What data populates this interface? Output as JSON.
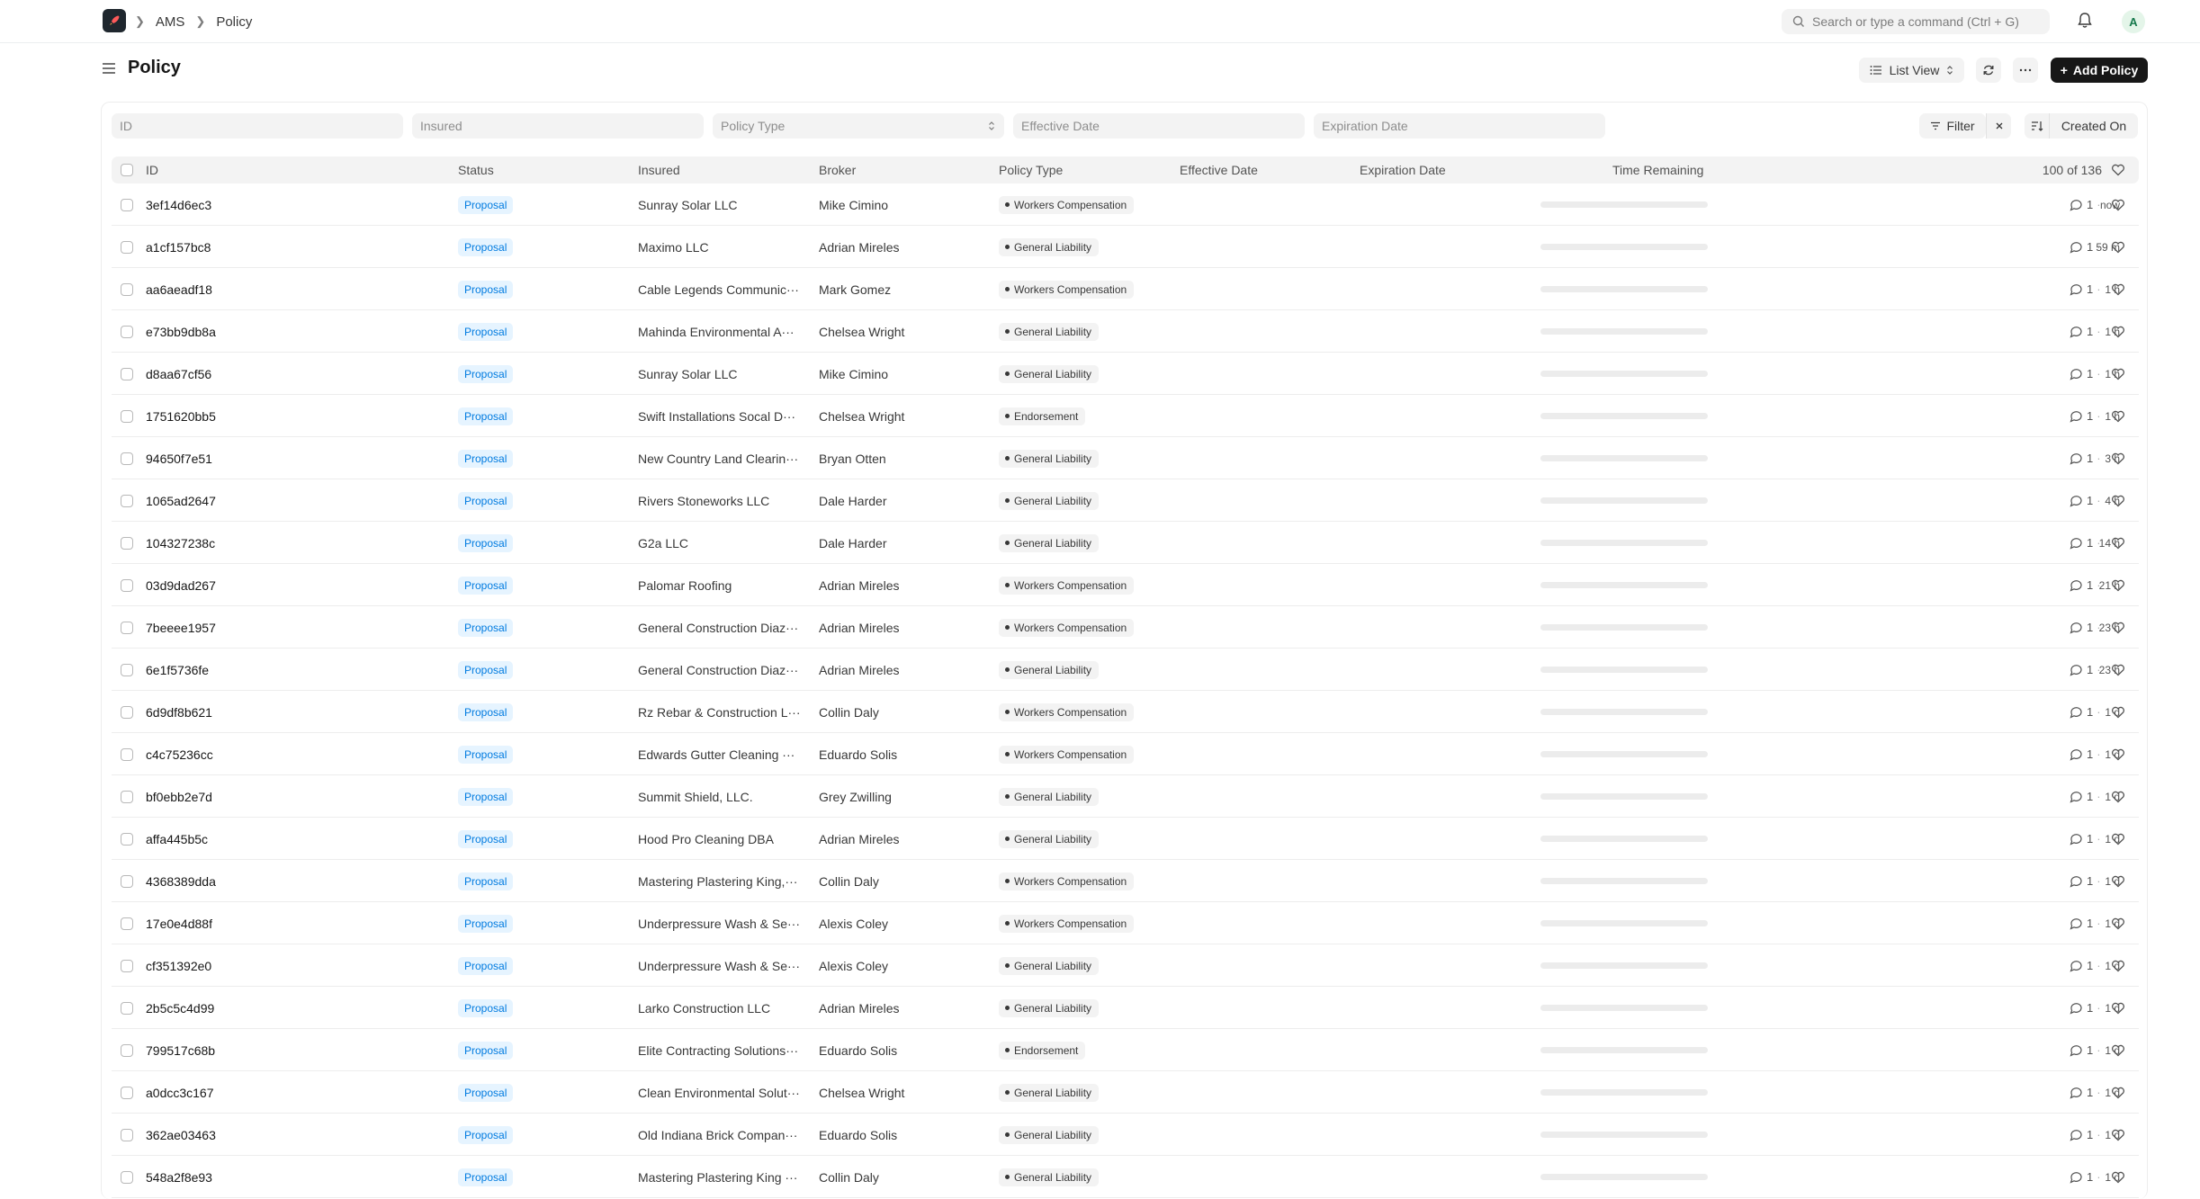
{
  "breadcrumbs": [
    "AMS",
    "Policy"
  ],
  "search": {
    "placeholder": "Search or type a command (Ctrl + G)"
  },
  "user": {
    "initial": "A"
  },
  "page": {
    "title": "Policy"
  },
  "toolbar": {
    "view_label": "List View",
    "add_label": "Add Policy"
  },
  "filters": {
    "id_placeholder": "ID",
    "insured_placeholder": "Insured",
    "policy_type_placeholder": "Policy Type",
    "effective_date_placeholder": "Effective Date",
    "expiration_date_placeholder": "Expiration Date",
    "filter_label": "Filter",
    "sort_label": "Created On"
  },
  "table": {
    "columns": {
      "id": "ID",
      "status": "Status",
      "insured": "Insured",
      "broker": "Broker",
      "policy_type": "Policy Type",
      "effective_date": "Effective Date",
      "expiration_date": "Expiration Date",
      "time_remaining": "Time Remaining"
    },
    "count": "100 of 136",
    "rows": [
      {
        "id": "3ef14d6ec3",
        "status": "Proposal",
        "insured": "Sunray Solar LLC",
        "broker": "Mike Cimino",
        "policy_type": "Workers Compensation",
        "time": "now",
        "comments": "1"
      },
      {
        "id": "a1cf157bc8",
        "status": "Proposal",
        "insured": "Maximo LLC",
        "broker": "Adrian Mireles",
        "policy_type": "General Liability",
        "time": "59 m",
        "comments": "1"
      },
      {
        "id": "aa6aeadf18",
        "status": "Proposal",
        "insured": "Cable Legends Communic···",
        "broker": "Mark Gomez",
        "policy_type": "Workers Compensation",
        "time": "1 h",
        "comments": "1"
      },
      {
        "id": "e73bb9db8a",
        "status": "Proposal",
        "insured": "Mahinda Environmental A···",
        "broker": "Chelsea Wright",
        "policy_type": "General Liability",
        "time": "1 h",
        "comments": "1"
      },
      {
        "id": "d8aa67cf56",
        "status": "Proposal",
        "insured": "Sunray Solar LLC",
        "broker": "Mike Cimino",
        "policy_type": "General Liability",
        "time": "1 h",
        "comments": "1"
      },
      {
        "id": "1751620bb5",
        "status": "Proposal",
        "insured": "Swift Installations Socal D···",
        "broker": "Chelsea Wright",
        "policy_type": "Endorsement",
        "time": "1 h",
        "comments": "1"
      },
      {
        "id": "94650f7e51",
        "status": "Proposal",
        "insured": "New Country Land Clearin···",
        "broker": "Bryan Otten",
        "policy_type": "General Liability",
        "time": "3 h",
        "comments": "1"
      },
      {
        "id": "1065ad2647",
        "status": "Proposal",
        "insured": "Rivers Stoneworks LLC",
        "broker": "Dale Harder",
        "policy_type": "General Liability",
        "time": "4 h",
        "comments": "1"
      },
      {
        "id": "104327238c",
        "status": "Proposal",
        "insured": "G2a LLC",
        "broker": "Dale Harder",
        "policy_type": "General Liability",
        "time": "14 h",
        "comments": "1"
      },
      {
        "id": "03d9dad267",
        "status": "Proposal",
        "insured": "Palomar Roofing",
        "broker": "Adrian Mireles",
        "policy_type": "Workers Compensation",
        "time": "21 h",
        "comments": "1"
      },
      {
        "id": "7beeee1957",
        "status": "Proposal",
        "insured": "General Construction Diaz···",
        "broker": "Adrian Mireles",
        "policy_type": "Workers Compensation",
        "time": "23 h",
        "comments": "1"
      },
      {
        "id": "6e1f5736fe",
        "status": "Proposal",
        "insured": "General Construction Diaz···",
        "broker": "Adrian Mireles",
        "policy_type": "General Liability",
        "time": "23 h",
        "comments": "1"
      },
      {
        "id": "6d9df8b621",
        "status": "Proposal",
        "insured": "Rz Rebar & Construction L···",
        "broker": "Collin Daly",
        "policy_type": "Workers Compensation",
        "time": "1 d",
        "comments": "1"
      },
      {
        "id": "c4c75236cc",
        "status": "Proposal",
        "insured": "Edwards Gutter Cleaning ···",
        "broker": "Eduardo Solis",
        "policy_type": "Workers Compensation",
        "time": "1 d",
        "comments": "1"
      },
      {
        "id": "bf0ebb2e7d",
        "status": "Proposal",
        "insured": "Summit Shield, LLC.",
        "broker": "Grey Zwilling",
        "policy_type": "General Liability",
        "time": "1 d",
        "comments": "1"
      },
      {
        "id": "affa445b5c",
        "status": "Proposal",
        "insured": "Hood Pro Cleaning DBA",
        "broker": "Adrian Mireles",
        "policy_type": "General Liability",
        "time": "1 d",
        "comments": "1"
      },
      {
        "id": "4368389dda",
        "status": "Proposal",
        "insured": "Mastering Plastering King,···",
        "broker": "Collin Daly",
        "policy_type": "Workers Compensation",
        "time": "1 d",
        "comments": "1"
      },
      {
        "id": "17e0e4d88f",
        "status": "Proposal",
        "insured": "Underpressure Wash & Se···",
        "broker": "Alexis Coley",
        "policy_type": "Workers Compensation",
        "time": "1 d",
        "comments": "1"
      },
      {
        "id": "cf351392e0",
        "status": "Proposal",
        "insured": "Underpressure Wash & Se···",
        "broker": "Alexis Coley",
        "policy_type": "General Liability",
        "time": "1 d",
        "comments": "1"
      },
      {
        "id": "2b5c5c4d99",
        "status": "Proposal",
        "insured": "Larko Construction LLC",
        "broker": "Adrian Mireles",
        "policy_type": "General Liability",
        "time": "1 d",
        "comments": "1"
      },
      {
        "id": "799517c68b",
        "status": "Proposal",
        "insured": "Elite Contracting Solutions···",
        "broker": "Eduardo Solis",
        "policy_type": "Endorsement",
        "time": "1 d",
        "comments": "1"
      },
      {
        "id": "a0dcc3c167",
        "status": "Proposal",
        "insured": "Clean Environmental Solut···",
        "broker": "Chelsea Wright",
        "policy_type": "General Liability",
        "time": "1 d",
        "comments": "1"
      },
      {
        "id": "362ae03463",
        "status": "Proposal",
        "insured": "Old Indiana Brick Compan···",
        "broker": "Eduardo Solis",
        "policy_type": "General Liability",
        "time": "1 d",
        "comments": "1"
      },
      {
        "id": "548a2f8e93",
        "status": "Proposal",
        "insured": "Mastering Plastering King ···",
        "broker": "Collin Daly",
        "policy_type": "General Liability",
        "time": "1 d",
        "comments": "1"
      }
    ]
  }
}
